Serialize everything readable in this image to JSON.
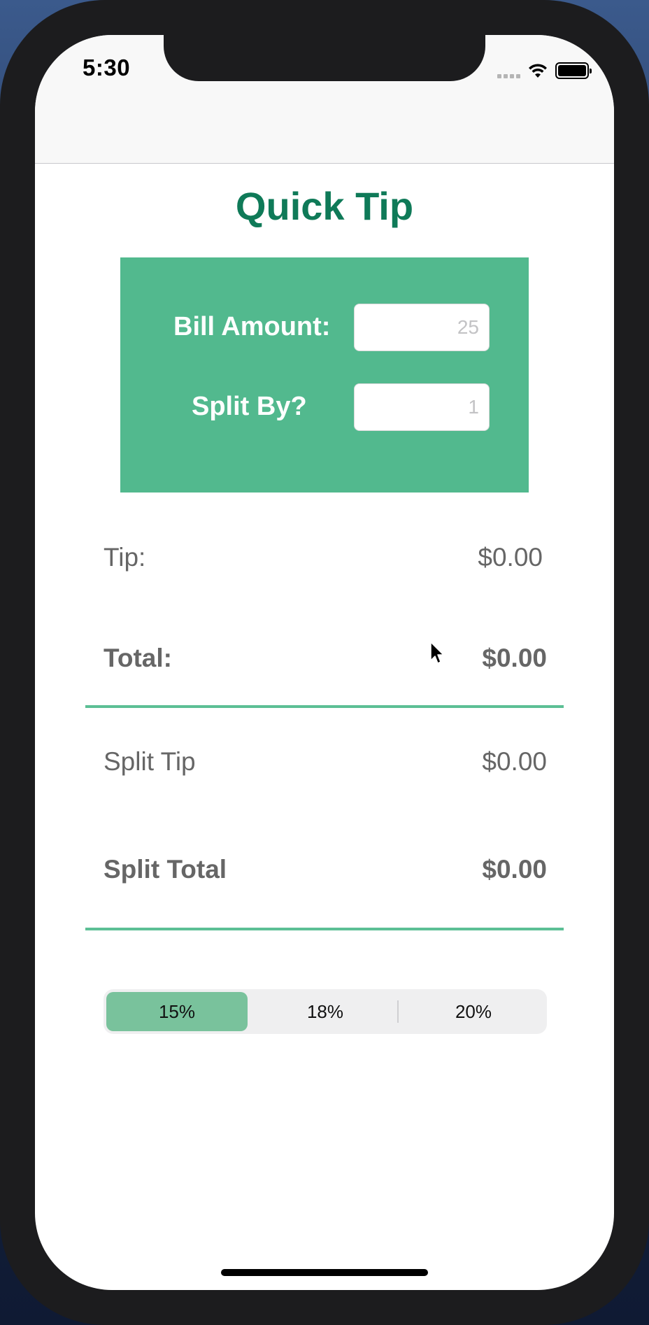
{
  "status_bar": {
    "time": "5:30",
    "signal_icon": "cellular-signal-icon",
    "wifi_icon": "wifi-icon",
    "battery_icon": "battery-icon"
  },
  "app": {
    "title": "Quick Tip",
    "title_color": "#0f7a58",
    "accent_color": "#52b98e"
  },
  "inputs": {
    "bill_label": "Bill Amount:",
    "bill_placeholder": "25",
    "split_label": "Split By?",
    "split_placeholder": "1"
  },
  "results": {
    "tip_label": "Tip:",
    "tip_value": "$0.00",
    "total_label": "Total:",
    "total_value": "$0.00",
    "split_tip_label": "Split Tip",
    "split_tip_value": "$0.00",
    "split_total_label": "Split Total",
    "split_total_value": "$0.00"
  },
  "tip_selector": {
    "options": [
      "15%",
      "18%",
      "20%"
    ],
    "selected": "15%"
  }
}
